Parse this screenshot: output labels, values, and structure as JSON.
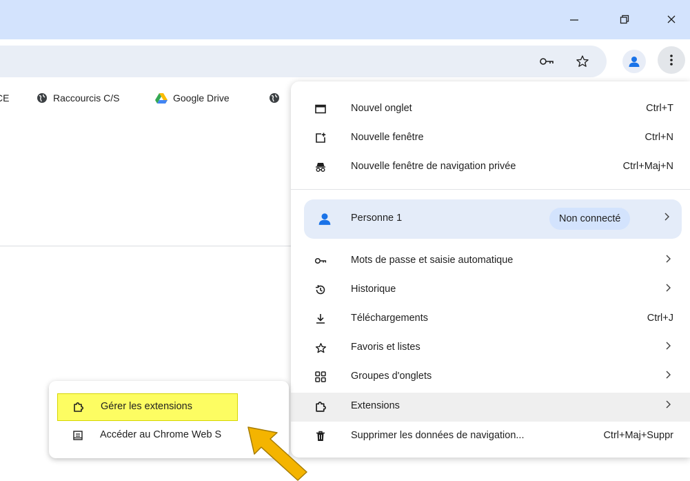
{
  "bookmarks": [
    {
      "label": "CE",
      "icon": "globe-icon"
    },
    {
      "label": "Raccourcis C/S",
      "icon": "globe-icon"
    },
    {
      "label": "Google Drive",
      "icon": "google-drive-icon"
    }
  ],
  "menu": {
    "new_tab": {
      "label": "Nouvel onglet",
      "shortcut": "Ctrl+T"
    },
    "new_window": {
      "label": "Nouvelle fenêtre",
      "shortcut": "Ctrl+N"
    },
    "incognito": {
      "label": "Nouvelle fenêtre de navigation privée",
      "shortcut": "Ctrl+Maj+N"
    },
    "profile": {
      "name": "Personne 1",
      "status": "Non connecté"
    },
    "passwords": {
      "label": "Mots de passe et saisie automatique"
    },
    "history": {
      "label": "Historique"
    },
    "downloads": {
      "label": "Téléchargements",
      "shortcut": "Ctrl+J"
    },
    "bookmarks": {
      "label": "Favoris et listes"
    },
    "tab_groups": {
      "label": "Groupes d'onglets"
    },
    "extensions": {
      "label": "Extensions"
    },
    "clear_data": {
      "label": "Supprimer les données de navigation...",
      "shortcut": "Ctrl+Maj+Suppr"
    }
  },
  "submenu": {
    "manage": {
      "label": "Gérer les extensions"
    },
    "webstore": {
      "label": "Accéder au Chrome Web S"
    }
  },
  "colors": {
    "titlebar": "#d3e3fd",
    "highlight": "#fdfd62",
    "arrow": "#f4b400",
    "profile_bg": "#e4ecf9",
    "accent": "#1a73e8"
  }
}
